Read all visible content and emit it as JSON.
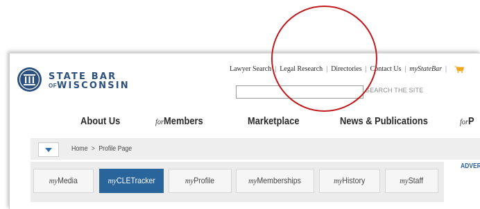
{
  "brand": {
    "line1": "STATE BAR",
    "of": "OF",
    "line2": "WISCONSIN",
    "color": "#2b4f7e"
  },
  "toplinks": [
    "Lawyer Search",
    "Legal Research",
    "Directories",
    "Contact Us",
    "myStateBar"
  ],
  "cart_icon": "shopping-cart-icon",
  "search": {
    "value": "",
    "button_label": "SEARCH THE SITE"
  },
  "nav": {
    "about": "About Us",
    "members_prefix": "for",
    "members": "Members",
    "marketplace": "Marketplace",
    "news": "News & Publications",
    "public_prefix": "for",
    "public": "P"
  },
  "breadcrumb": {
    "home": "Home",
    "separator": ">",
    "current": "Profile Page"
  },
  "tabs": [
    {
      "prefix": "my",
      "label": "Media"
    },
    {
      "prefix": "my",
      "label": "CLETracker"
    },
    {
      "prefix": "my",
      "label": "Profile"
    },
    {
      "prefix": "my",
      "label": "Memberships"
    },
    {
      "prefix": "my",
      "label": "History"
    },
    {
      "prefix": "my",
      "label": "Staff"
    }
  ],
  "active_tab": "myCLETracker",
  "adver_label": "ADVER",
  "colors": {
    "accent": "#29649b",
    "annotation": "#c0191c",
    "cart": "#f2a61d"
  }
}
